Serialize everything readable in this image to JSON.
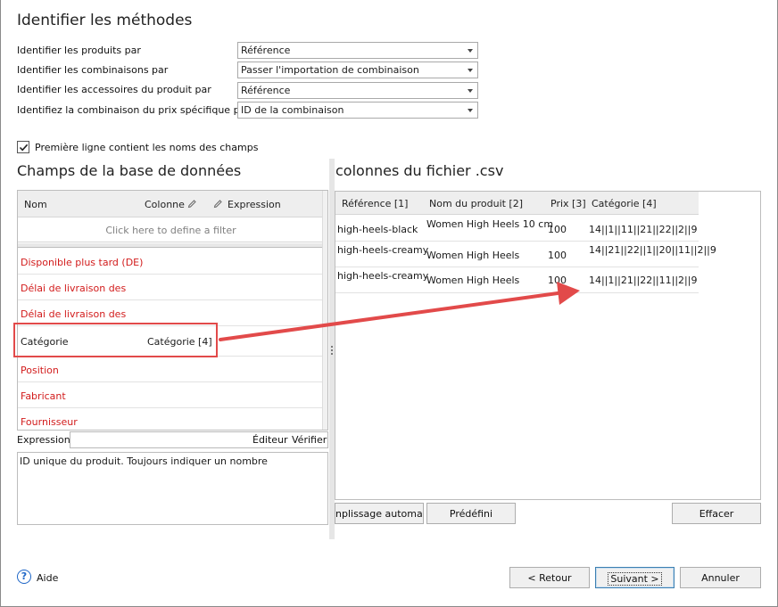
{
  "title": "Identifier les méthodes",
  "identify": [
    {
      "label": "Identifier les produits par",
      "value": "Référence"
    },
    {
      "label": "Identifier les combinaisons par",
      "value": "Passer l'importation de combinaison"
    },
    {
      "label": "Identifier les accessoires du produit par",
      "value": "Référence"
    },
    {
      "label": "Identifiez la combinaison du prix spécifique par",
      "value": "ID de la combinaison"
    }
  ],
  "first_row_checkbox": {
    "label": "Première ligne contient les noms des champs",
    "checked": true
  },
  "left_panel": {
    "title": "Champs de la base de données",
    "columns": {
      "name": "Nom",
      "column": "Colonne",
      "expression": "Expression"
    },
    "filter_placeholder": "Click here to define a filter",
    "rows": [
      {
        "name": "Disponible plus tard (DE)",
        "column": "",
        "required": true
      },
      {
        "name": "Délai de livraison des",
        "column": "",
        "required": true
      },
      {
        "name": "Délai de livraison des",
        "column": "",
        "required": true
      },
      {
        "name": "Catégorie",
        "column": "Catégorie [4]",
        "required": false
      },
      {
        "name": "Position",
        "column": "",
        "required": true
      },
      {
        "name": "Fabricant",
        "column": "",
        "required": true
      },
      {
        "name": "Fournisseur",
        "column": "",
        "required": true
      }
    ],
    "expression_label": "Expression",
    "editor_label": "Éditeur",
    "verify_label": "Vérifier",
    "description": "ID unique du produit. Toujours indiquer un nombre"
  },
  "right_panel": {
    "title": "colonnes du fichier .csv",
    "columns": [
      "Référence [1]",
      "Nom du produit [2]",
      "Prix [3]",
      "Catégorie [4]"
    ],
    "rows": [
      [
        "high-heels-black",
        "Women High Heels 10 cm",
        "100",
        "14||1||11||21||22||2||9"
      ],
      [
        "high-heels-creamy",
        "Women High Heels",
        "100",
        "14||21||22||1||20||11||2||9"
      ],
      [
        "high-heels-creamy",
        "Women High Heels",
        "100",
        "14||1||21||22||11||2||9"
      ]
    ],
    "autofill_label": "nplissage automatiq",
    "predefined_label": "Prédéfini",
    "clear_label": "Effacer"
  },
  "footer": {
    "help_label": "Aide",
    "back_label": "< Retour",
    "next_label": "Suivant >",
    "cancel_label": "Annuler"
  },
  "colors": {
    "required_field": "#d21c1c",
    "highlight": "#e24a4a",
    "accent": "#1e66c7"
  },
  "icons": {
    "edit": "pencil-icon",
    "help": "help-circle-icon",
    "check": "checkmark-icon",
    "dropdown": "chevron-down-icon"
  }
}
